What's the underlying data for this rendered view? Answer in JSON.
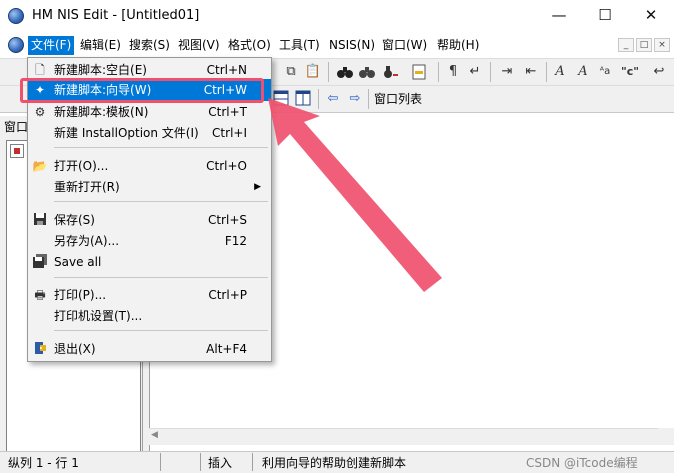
{
  "window": {
    "title": "HM NIS Edit - [Untitled01]",
    "minimize_glyph": "—",
    "maximize_glyph": "☐",
    "close_glyph": "✕"
  },
  "menubar": {
    "items": [
      {
        "label": "文件(F)",
        "active": true
      },
      {
        "label": "编辑(E)"
      },
      {
        "label": "搜索(S)"
      },
      {
        "label": "视图(V)"
      },
      {
        "label": "格式(O)"
      },
      {
        "label": "工具(T)"
      },
      {
        "label": "NSIS(N)"
      },
      {
        "label": "窗口(W)"
      },
      {
        "label": "帮助(H)"
      }
    ],
    "mdi_controls": [
      "_",
      "□",
      "×"
    ]
  },
  "toolbar": {
    "window_list_label": "窗口列表",
    "find_icon": "find-binoculars-icon",
    "format_labels": [
      "A",
      "A",
      "\"c\""
    ]
  },
  "left_panel": {
    "title": "窗口"
  },
  "file_menu": {
    "items": [
      {
        "label": "新建脚本:空白(E)",
        "shortcut": "Ctrl+N",
        "icon": "new-file-icon"
      },
      {
        "label": "新建脚本:向导(W)",
        "shortcut": "Ctrl+W",
        "icon": "wizard-icon",
        "highlighted": true
      },
      {
        "label": "新建脚本:模板(N)",
        "shortcut": "Ctrl+T",
        "icon": "template-icon"
      },
      {
        "label": "新建 InstallOption 文件(I)",
        "shortcut": "Ctrl+I",
        "icon": ""
      },
      {
        "label": "打开(O)...",
        "shortcut": "Ctrl+O",
        "icon": "open-folder-icon"
      },
      {
        "label": "重新打开(R)",
        "shortcut": "",
        "icon": "",
        "submenu": true
      },
      {
        "label": "保存(S)",
        "shortcut": "Ctrl+S",
        "icon": "save-icon"
      },
      {
        "label": "另存为(A)...",
        "shortcut": "F12",
        "icon": ""
      },
      {
        "label": "Save all",
        "shortcut": "",
        "icon": "save-all-icon"
      },
      {
        "label": "打印(P)...",
        "shortcut": "Ctrl+P",
        "icon": "printer-icon"
      },
      {
        "label": "打印机设置(T)...",
        "shortcut": "",
        "icon": ""
      },
      {
        "label": "退出(X)",
        "shortcut": "Alt+F4",
        "icon": "exit-door-icon"
      }
    ]
  },
  "statusbar": {
    "position": "纵列 1 - 行 1",
    "mode": "插入",
    "hint": "利用向导的帮助创建新脚本"
  },
  "watermark": "CSDN @iTcode编程"
}
